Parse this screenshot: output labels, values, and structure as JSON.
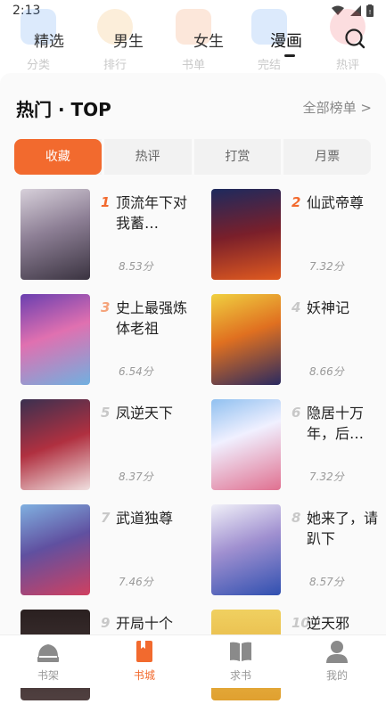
{
  "status": {
    "time": "2:13"
  },
  "ghost_row": [
    "分类",
    "排行",
    "书单",
    "完结",
    "热评"
  ],
  "top_tabs": [
    "精选",
    "男生",
    "女生",
    "漫画"
  ],
  "active_top_tab": 3,
  "section": {
    "title": "热门 · TOP",
    "see_all": "全部榜单 >"
  },
  "segments": [
    "收藏",
    "热评",
    "打赏",
    "月票"
  ],
  "active_segment": 0,
  "items": [
    {
      "rank": "1",
      "title": "顶流年下对我蓄…",
      "score": "8.53分",
      "rank_color": "#f26a2e"
    },
    {
      "rank": "2",
      "title": "仙武帝尊",
      "score": "7.32分",
      "rank_color": "#f26a2e"
    },
    {
      "rank": "3",
      "title": "史上最强炼体老祖",
      "score": "6.54分",
      "rank_color": "#f5a37a"
    },
    {
      "rank": "4",
      "title": "妖神记",
      "score": "8.66分",
      "rank_color": "#c8c8c8"
    },
    {
      "rank": "5",
      "title": "凤逆天下",
      "score": "8.37分",
      "rank_color": "#c8c8c8"
    },
    {
      "rank": "6",
      "title": "隐居十万年，后…",
      "score": "7.32分",
      "rank_color": "#c8c8c8"
    },
    {
      "rank": "7",
      "title": "武道独尊",
      "score": "7.46分",
      "rank_color": "#c8c8c8"
    },
    {
      "rank": "8",
      "title": "她来了，请趴下",
      "score": "8.57分",
      "rank_color": "#c8c8c8"
    },
    {
      "rank": "9",
      "title": "开局十个",
      "score": "",
      "rank_color": "#c8c8c8"
    },
    {
      "rank": "10",
      "title": "逆天邪",
      "score": "",
      "rank_color": "#c8c8c8"
    }
  ],
  "bottom_nav": [
    "书架",
    "书城",
    "求书",
    "我的"
  ],
  "active_bottom": 1,
  "colors": {
    "accent": "#f26a2e"
  }
}
